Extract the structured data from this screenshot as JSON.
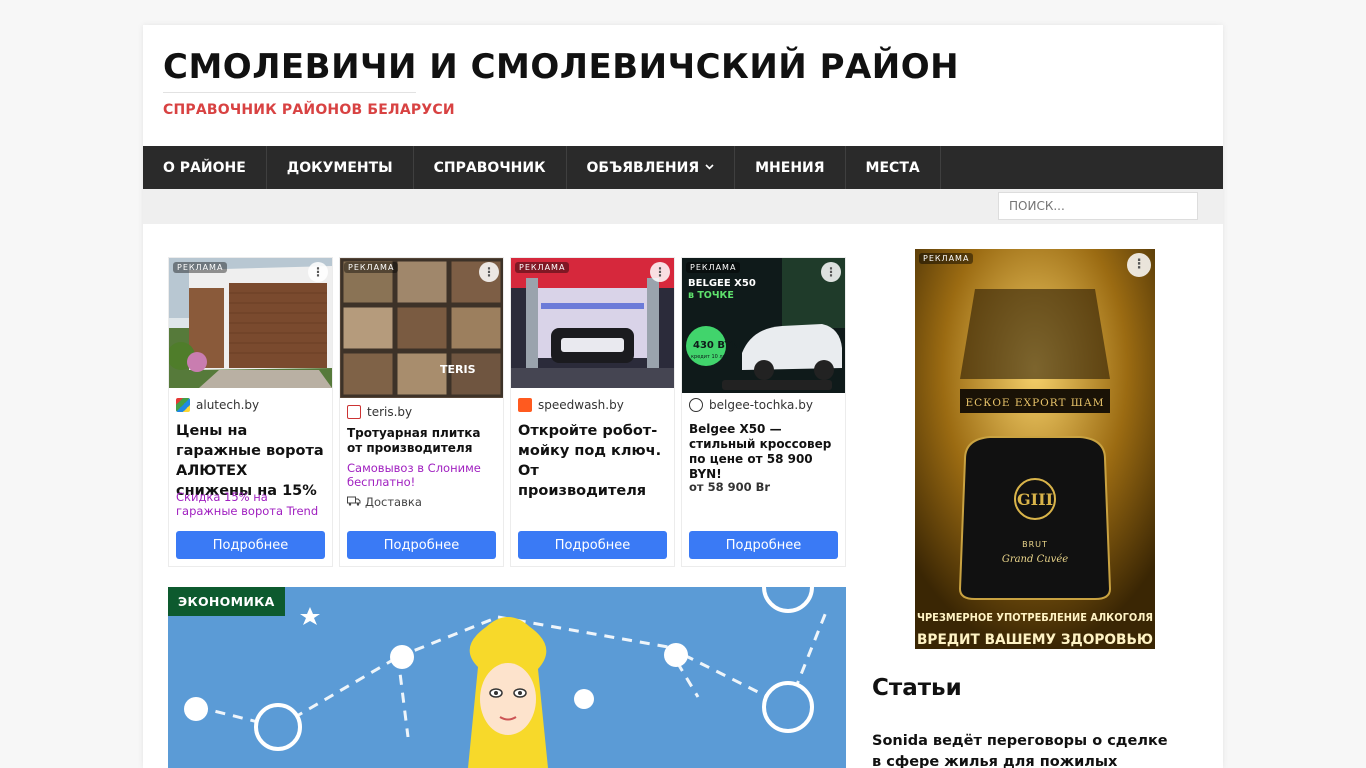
{
  "header": {
    "title": "СМОЛЕВИЧИ И СМОЛЕВИЧСКИЙ РАЙОН",
    "description": "СПРАВОЧНИК РАЙОНОВ БЕЛАРУСИ"
  },
  "nav": {
    "items": [
      "О РАЙОНЕ",
      "ДОКУМЕНТЫ",
      "СПРАВОЧНИК",
      "ОБЪЯВЛЕНИЯ",
      "МНЕНИЯ",
      "МЕСТА"
    ]
  },
  "search": {
    "placeholder": "ПОИСК..."
  },
  "ads": {
    "label": "РЕКЛАМА",
    "button_label": "Подробнее",
    "items": [
      {
        "domain": "alutech.by",
        "title": "Цены на гаражные ворота АЛЮТЕХ снижены на 15%",
        "subtitle": "Скидка 15% на гаражные ворота Trend"
      },
      {
        "domain": "teris.by",
        "title": "Тротуарная плитка от производителя",
        "subtitle": "Самовывоз в Слониме бесплатно!",
        "delivery": "Доставка",
        "image_text": "TERIS"
      },
      {
        "domain": "speedwash.by",
        "title": "Откройте робот-мойку под ключ. От производителя"
      },
      {
        "domain": "belgee-tochka.by",
        "title": "Belgee X50 — стильный кроссовер по цене от 58 900 BYN!",
        "price": "от 58 900 Br",
        "image_headline": "BELGEE X50",
        "image_sub": "в ТОЧКЕ",
        "image_price": "430 BYN",
        "image_price_note": "кредит 10 лет"
      }
    ]
  },
  "feature": {
    "category": "ЭКОНОМИКА"
  },
  "sidebar": {
    "ad_label": "РЕКЛАМА",
    "ad_brand_text": "ЕСКОЕ EXPORT ШАМ",
    "ad_product_line1": "BRUT",
    "ad_product_line2": "Grand Cuvée",
    "ad_warning_line1": "ЧРЕЗМЕРНОЕ УПОТРЕБЛЕНИЕ АЛКОГОЛЯ",
    "ad_warning_line2": "ВРЕДИТ ВАШЕМУ ЗДОРОВЬЮ",
    "widget_title": "Статьи",
    "article_title": "Sonida ведёт переговоры о сделке в сфере жилья для пожилых людей"
  },
  "colors": {
    "accent_red": "#d84242",
    "nav_bg": "#2a2a2a",
    "category_green": "#0d5a2e",
    "ad_button_blue": "#3a7af5",
    "ad_subtitle_purple": "#a020c0"
  },
  "icons": [
    "chevron-down-icon",
    "more-vertical-icon",
    "truck-icon"
  ]
}
